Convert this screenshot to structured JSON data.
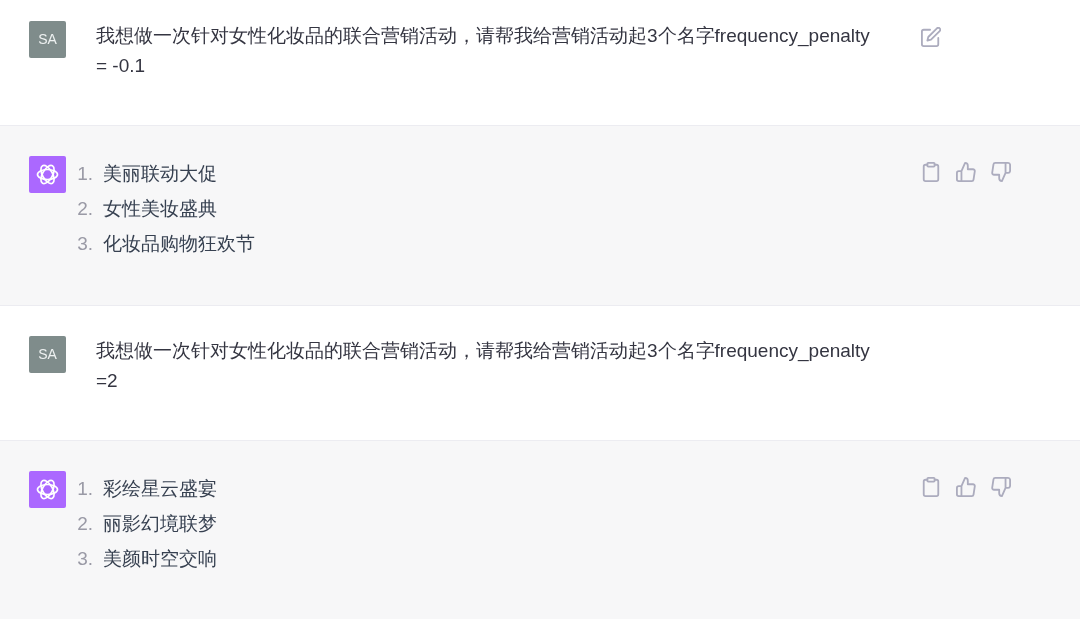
{
  "messages": [
    {
      "kind": "user",
      "avatar": "SA",
      "text": "我想做一次针对女性化妆品的联合营销活动，请帮我给营销活动起3个名字frequency_penalty\n= -0.1",
      "edit_button": true
    },
    {
      "kind": "assistant",
      "items": [
        {
          "number": "1.",
          "text": "美丽联动大促"
        },
        {
          "number": "2.",
          "text": "女性美妆盛典"
        },
        {
          "number": "3.",
          "text": "化妆品购物狂欢节"
        }
      ]
    },
    {
      "kind": "user",
      "avatar": "SA",
      "text": "我想做一次针对女性化妆品的联合营销活动，请帮我给营销活动起3个名字frequency_penalty\n=2",
      "edit_button": false
    },
    {
      "kind": "assistant",
      "items": [
        {
          "number": "1.",
          "text": "彩绘星云盛宴"
        },
        {
          "number": "2.",
          "text": "丽影幻境联梦"
        },
        {
          "number": "3.",
          "text": "美颜时空交响"
        }
      ]
    }
  ]
}
